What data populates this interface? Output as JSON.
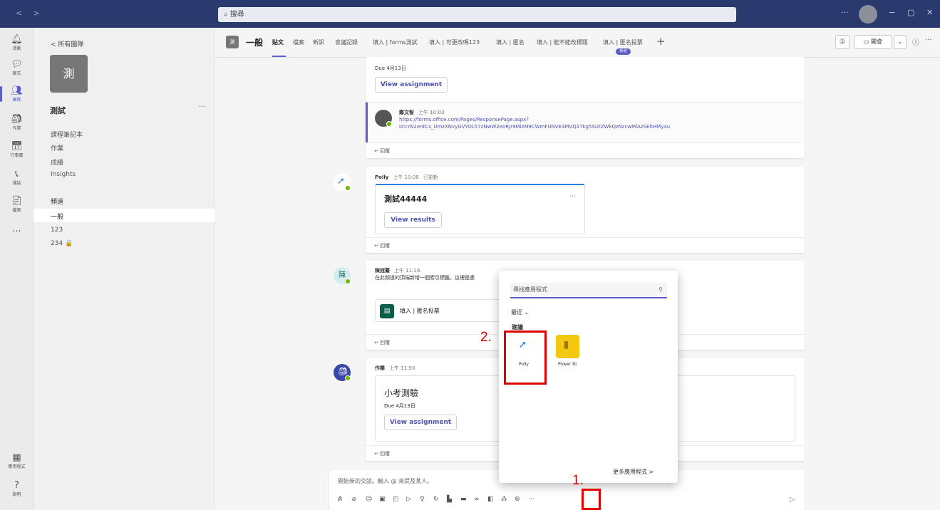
{
  "topbar": {
    "nav": "< >",
    "search_placeholder": "搜尋",
    "more": "···",
    "minimize": "−",
    "maximize": "▢",
    "close": "✕"
  },
  "rail": [
    {
      "icon": "bell-icon",
      "glyph": "🔔",
      "label": "活動"
    },
    {
      "icon": "chat-icon",
      "glyph": "💬",
      "label": "聊天"
    },
    {
      "icon": "teams-icon",
      "glyph": "👥",
      "label": "團隊",
      "active": true
    },
    {
      "icon": "assignments-icon",
      "glyph": "🎒",
      "label": "作業"
    },
    {
      "icon": "calendar-icon",
      "glyph": "📅",
      "label": "行事曆"
    },
    {
      "icon": "phone-icon",
      "glyph": "📞",
      "label": "通話"
    },
    {
      "icon": "file-icon",
      "glyph": "📄",
      "label": "檔案"
    },
    {
      "icon": "more-icon",
      "glyph": "···",
      "label": ""
    }
  ],
  "rail_bottom": [
    {
      "icon": "apps-icon",
      "glyph": "▦",
      "label": "應用程式"
    },
    {
      "icon": "help-icon",
      "glyph": "?",
      "label": "說明"
    }
  ],
  "team": {
    "back": "< 所有團隊",
    "tile": "測",
    "name": "測試",
    "more": "···",
    "links": [
      "課程筆記本",
      "作業",
      "成績",
      "Insights"
    ],
    "channels_header": "頻道",
    "channels": [
      "一般",
      "123",
      "234 🔒"
    ]
  },
  "channel": {
    "icon": "測",
    "name": "一般",
    "tabs": [
      "貼文",
      "檔案",
      "新訊",
      "會議記錄",
      "填入 | forms測試",
      "填入 | 可更改嗎123",
      "填入 | 匿名",
      "填入 | 能不能改標題",
      "填入 | 匿名投票"
    ],
    "badge": "新增",
    "add": "+",
    "meet": "開會",
    "info": "ⓘ",
    "more": "···"
  },
  "posts": {
    "p1": {
      "due": "Due 4月13日",
      "button": "View assignment",
      "reply": "回覆"
    },
    "p2": {
      "author": "鄭文智",
      "time": "上午 10:03",
      "link1": "https://forms.office.com/Pages/ResponsePage.aspx?",
      "link2": "id=rN2entCs_UmzXNvyGVYOL57zNwW2eoRJr9MizM9CWmFUNVE4MVQ1Tkg5SUtZWkQzNzcwMlAzSEhHMy4u"
    },
    "p3": {
      "author": "Polly",
      "time": "上午 10:08",
      "edited": "已更新",
      "title": "測試44444",
      "more": "···",
      "button": "View results",
      "reply": "回覆"
    },
    "p4": {
      "avatar": "陳",
      "author": "陳冠蓁",
      "time": "上午 11:16",
      "text": "在此頻道的頂端新增一個索引標籤。這裡是連",
      "tab_name": "填入 | 匿名投票",
      "reply": "回覆"
    },
    "p5": {
      "author": "作業",
      "time": "上午 11:50",
      "title": "小考測驗",
      "due": "Due 4月13日",
      "button": "View assignment",
      "reply": "回覆"
    }
  },
  "compose": {
    "placeholder": "開始新的交談。輸入 @ 來提及某人。",
    "send": "▷"
  },
  "flyout": {
    "search_placeholder": "尋找應用程式",
    "recent": "最近 ⌄",
    "suggested": "建議",
    "apps": [
      {
        "name": "Polly",
        "color": "#ffffff"
      },
      {
        "name": "Power BI",
        "color": "#f2c811"
      }
    ],
    "more_apps": "更多應用程式  >"
  },
  "annotations": {
    "step1": "1.",
    "step2": "2."
  }
}
